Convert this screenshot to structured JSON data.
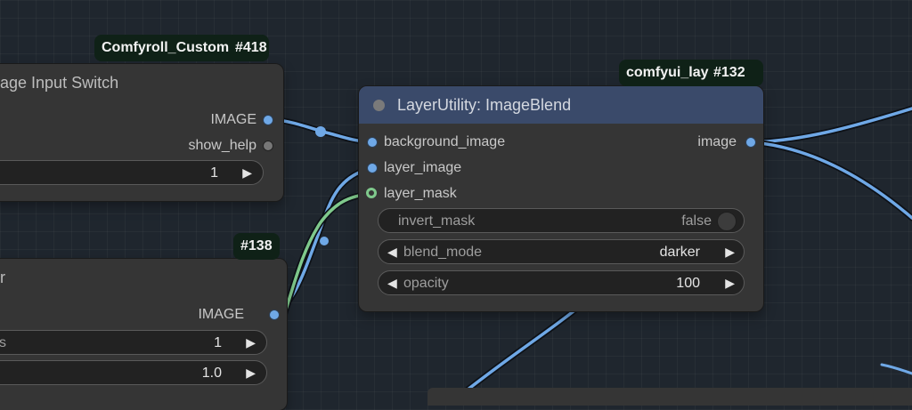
{
  "colors": {
    "canvas_bg": "#1f262e",
    "node_bg": "#353535",
    "title_blue": "#3a4a6a",
    "wire_blue": "#6fa8e6",
    "wire_green": "#7fc98c",
    "badge_bg": "#0f2117"
  },
  "nodes": {
    "switch": {
      "badge_name": "Comfyroll_Custom",
      "badge_id": "#418",
      "title": "age Input Switch",
      "outputs": [
        {
          "label": "IMAGE",
          "icon": "socket-blue"
        },
        {
          "label": "show_help",
          "icon": "socket-gray"
        }
      ],
      "widget_value": "1"
    },
    "blend": {
      "badge_name": "comfyui_lay",
      "badge_id": "#132",
      "title": "LayerUtility: ImageBlend",
      "inputs": [
        {
          "label": "background_image"
        },
        {
          "label": "layer_image"
        },
        {
          "label": "layer_mask"
        }
      ],
      "output": {
        "label": "image"
      },
      "widgets": {
        "invert_mask": {
          "label": "invert_mask",
          "value": "false"
        },
        "blend_mode": {
          "label": "blend_mode",
          "value": "darker"
        },
        "opacity": {
          "label": "opacity",
          "value": "100"
        }
      }
    },
    "lower": {
      "badge_id": "#138",
      "title": "r",
      "output": {
        "label": "IMAGE"
      },
      "widgets": [
        {
          "label": "s",
          "value": "1"
        },
        {
          "label": "",
          "value": "1.0"
        }
      ]
    }
  }
}
